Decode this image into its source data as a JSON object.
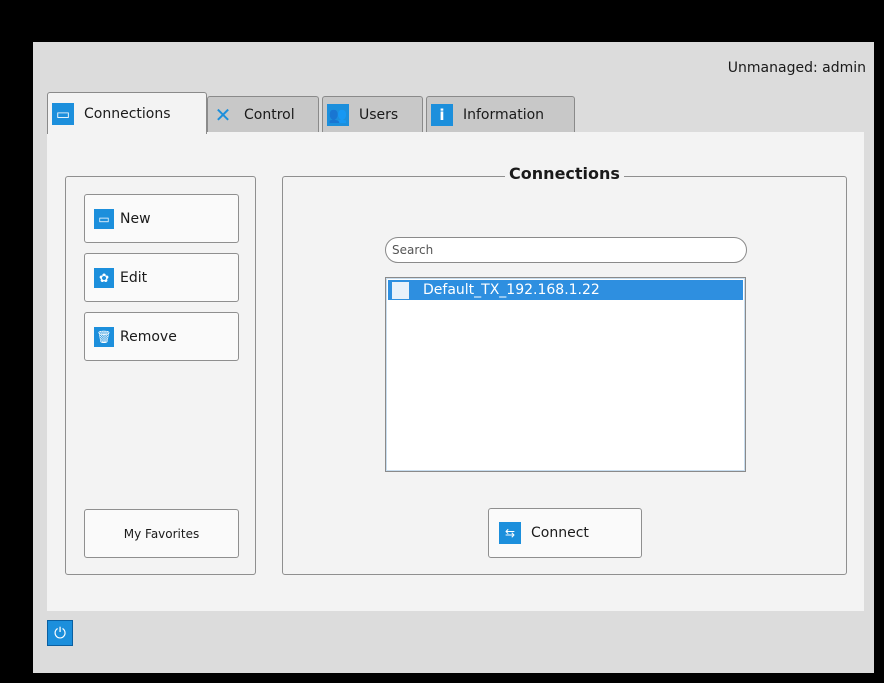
{
  "header": {
    "user_label": "Unmanaged: admin"
  },
  "tabs": [
    {
      "label": "Connections",
      "icon": "monitor-icon"
    },
    {
      "label": "Control",
      "icon": "tools-icon"
    },
    {
      "label": "Users",
      "icon": "users-icon"
    },
    {
      "label": "Information",
      "icon": "info-icon"
    }
  ],
  "sidebar": {
    "new_label": "New",
    "edit_label": "Edit",
    "remove_label": "Remove",
    "favorites_label": "My Favorites"
  },
  "connections": {
    "title": "Connections",
    "search_placeholder": "Search",
    "items": [
      {
        "name": "Default_TX_192.168.1.22",
        "selected": true
      }
    ],
    "connect_label": "Connect"
  },
  "colors": {
    "accent": "#1c8fdc",
    "selection": "#2e8fe0"
  }
}
